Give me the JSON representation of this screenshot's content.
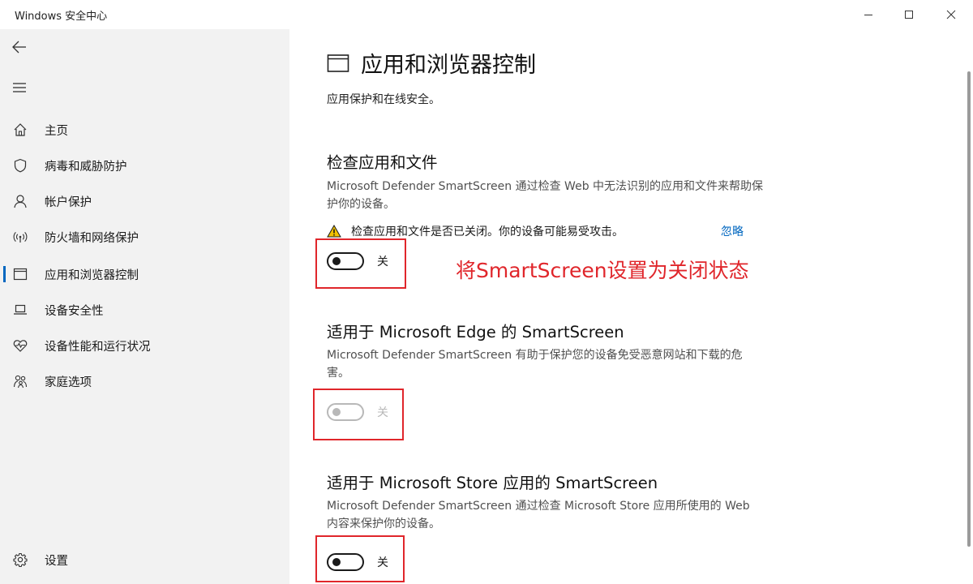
{
  "window": {
    "title": "Windows 安全中心"
  },
  "sidebar": {
    "items": [
      {
        "label": "主页",
        "icon": "home-icon"
      },
      {
        "label": "病毒和威胁防护",
        "icon": "shield-icon"
      },
      {
        "label": "帐户保护",
        "icon": "person-icon"
      },
      {
        "label": "防火墙和网络保护",
        "icon": "wireless-icon"
      },
      {
        "label": "应用和浏览器控制",
        "icon": "app-window-icon",
        "active": true
      },
      {
        "label": "设备安全性",
        "icon": "laptop-icon"
      },
      {
        "label": "设备性能和运行状况",
        "icon": "heart-icon"
      },
      {
        "label": "家庭选项",
        "icon": "family-icon"
      }
    ],
    "settings_label": "设置"
  },
  "main": {
    "title": "应用和浏览器控制",
    "subtitle": "应用保护和在线安全。",
    "sections": [
      {
        "title": "检查应用和文件",
        "description": "Microsoft Defender SmartScreen 通过检查 Web 中无法识别的应用和文件来帮助保护你的设备。",
        "warning": "检查应用和文件是否已关闭。你的设备可能易受攻击。",
        "dismiss": "忽略",
        "toggle_label": "关",
        "toggle_state": "off",
        "toggle_enabled": true
      },
      {
        "title": "适用于 Microsoft Edge 的 SmartScreen",
        "description": "Microsoft Defender SmartScreen 有助于保护您的设备免受恶意网站和下载的危害。",
        "toggle_label": "关",
        "toggle_state": "off",
        "toggle_enabled": false
      },
      {
        "title": "适用于 Microsoft Store 应用的 SmartScreen",
        "description": "Microsoft Defender SmartScreen 通过检查 Microsoft Store 应用所使用的 Web 内容来保护你的设备。",
        "toggle_label": "关",
        "toggle_state": "off",
        "toggle_enabled": true
      }
    ],
    "annotation": "将SmartScreen设置为关闭状态"
  },
  "colors": {
    "sidebar_bg": "#f2f2f2",
    "accent": "#0067c0",
    "annotation_red": "#e0262b",
    "warning_yellow": "#f2c200"
  }
}
